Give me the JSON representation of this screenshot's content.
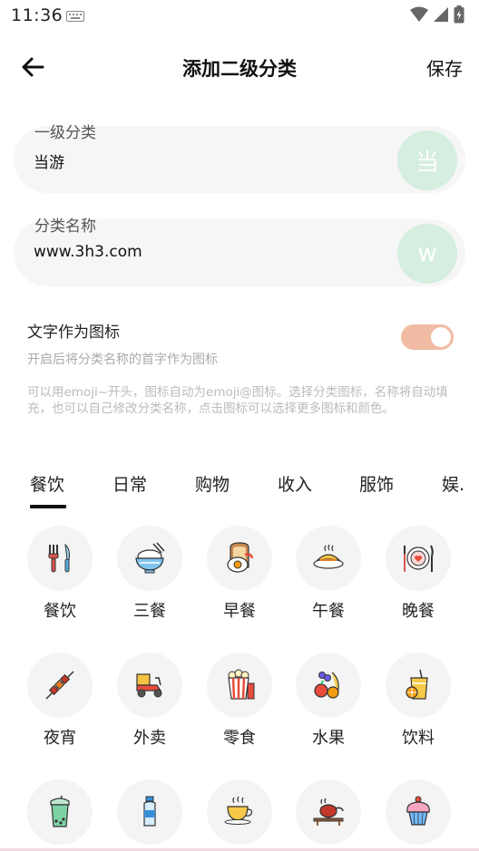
{
  "status": {
    "time": "11:36"
  },
  "header": {
    "title": "添加二级分类",
    "save_label": "保存"
  },
  "parent_field": {
    "label": "一级分类",
    "value": "当游",
    "avatar_text": "当"
  },
  "name_field": {
    "label": "分类名称",
    "value": "www.3h3.com",
    "avatar_text": "w"
  },
  "icon_toggle": {
    "title": "文字作为图标",
    "subtitle": "开启后将分类名称的首字作为图标",
    "on": true
  },
  "hint": "可以用emoji~开头，图标自动为emoji@图标。选择分类图标，名称将自动填充，也可以自己修改分类名称，点击图标可以选择更多图标和颜色。",
  "tabs": [
    "餐饮",
    "日常",
    "购物",
    "收入",
    "服饰",
    "娱."
  ],
  "active_tab": 0,
  "icons": [
    {
      "label": "餐饮",
      "icon": "cutlery-icon"
    },
    {
      "label": "三餐",
      "icon": "rice-bowl-icon"
    },
    {
      "label": "早餐",
      "icon": "toast-egg-icon"
    },
    {
      "label": "午餐",
      "icon": "lunch-plate-icon"
    },
    {
      "label": "晚餐",
      "icon": "dinner-plate-icon"
    },
    {
      "label": "夜宵",
      "icon": "skewer-icon"
    },
    {
      "label": "外卖",
      "icon": "delivery-scooter-icon"
    },
    {
      "label": "零食",
      "icon": "popcorn-icon"
    },
    {
      "label": "水果",
      "icon": "fruit-icon"
    },
    {
      "label": "饮料",
      "icon": "juice-icon"
    },
    {
      "label": "",
      "icon": "bubble-tea-icon"
    },
    {
      "label": "",
      "icon": "water-bottle-icon"
    },
    {
      "label": "",
      "icon": "coffee-cup-icon"
    },
    {
      "label": "",
      "icon": "teapot-icon"
    },
    {
      "label": "",
      "icon": "cupcake-icon"
    }
  ],
  "colors": {
    "avatar_bg": "#d5eedf",
    "toggle_on": "#f0bba2",
    "field_bg": "#f6f6f6"
  }
}
